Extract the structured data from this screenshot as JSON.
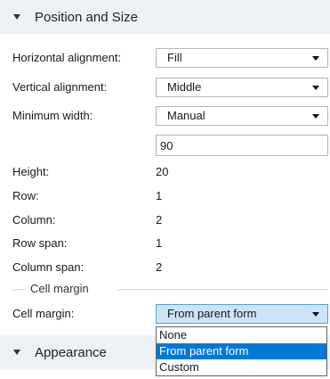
{
  "sections": {
    "position_size": {
      "title": "Position and Size"
    },
    "appearance": {
      "title": "Appearance"
    }
  },
  "fields": {
    "horizontal_alignment": {
      "label": "Horizontal alignment:",
      "value": "Fill"
    },
    "vertical_alignment": {
      "label": "Vertical alignment:",
      "value": "Middle"
    },
    "minimum_width": {
      "label": "Minimum width:",
      "value": "Manual",
      "input_value": "90"
    },
    "height": {
      "label": "Height:",
      "value": "20"
    },
    "row": {
      "label": "Row:",
      "value": "1"
    },
    "column": {
      "label": "Column:",
      "value": "2"
    },
    "row_span": {
      "label": "Row span:",
      "value": "1"
    },
    "column_span": {
      "label": "Column span:",
      "value": "2"
    }
  },
  "cell_margin_group": {
    "title": "Cell margin",
    "label": "Cell margin:",
    "value": "From parent form",
    "options": [
      "None",
      "From parent form",
      "Custom"
    ],
    "selected_option": "From parent form"
  },
  "colors": {
    "section_bg": "#edf1f6",
    "active_select_bg": "#cce4f7",
    "selected_option_bg": "#0078d7"
  }
}
